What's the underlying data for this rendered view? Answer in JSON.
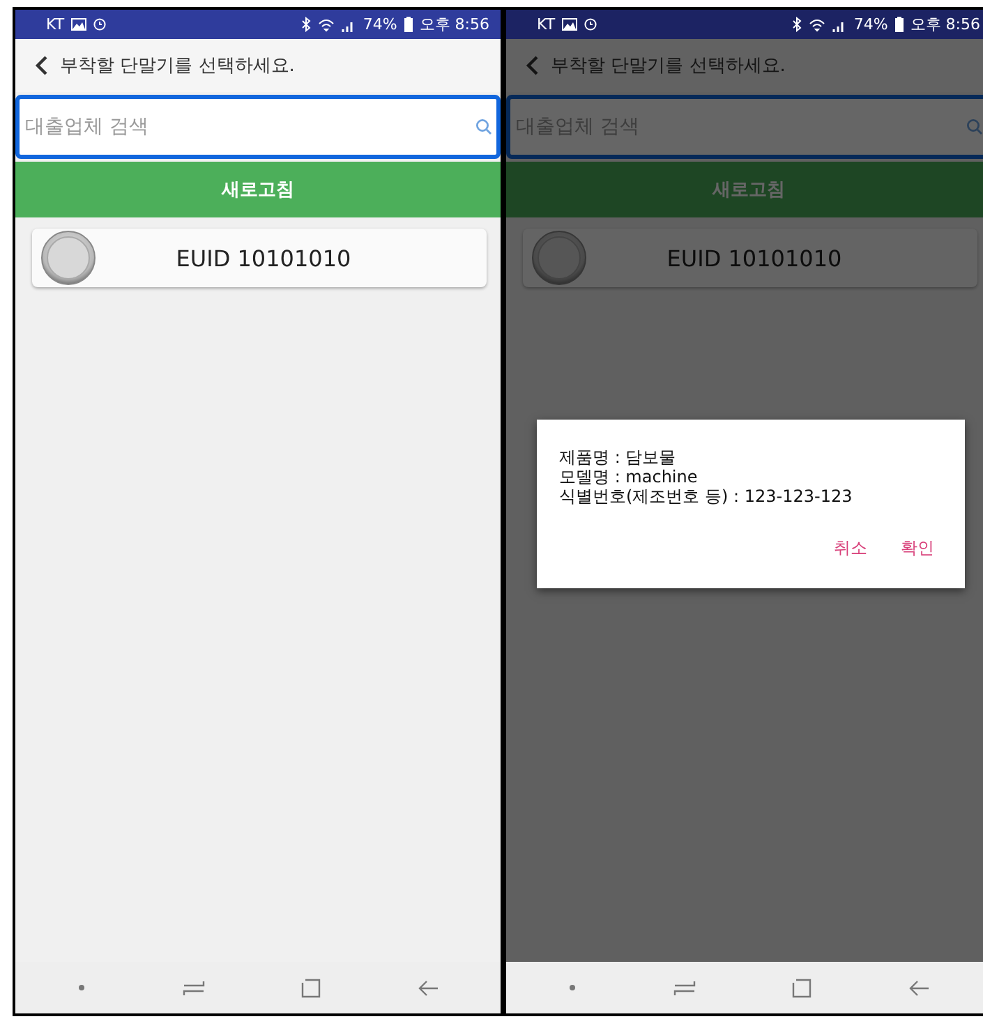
{
  "phones": [
    {
      "dimmed": false,
      "status_bar": {
        "carrier": "KT",
        "battery": "74%",
        "time": "오후 8:56"
      },
      "header": {
        "title": "부착할 단말기를 선택하세요."
      },
      "search": {
        "placeholder": "대출업체 검색"
      },
      "refresh_button": "새로고침",
      "devices": [
        {
          "label": "EUID 10101010"
        }
      ]
    },
    {
      "dimmed": true,
      "status_bar": {
        "carrier": "KT",
        "battery": "74%",
        "time": "오후 8:56"
      },
      "header": {
        "title": "부착할 단말기를 선택하세요."
      },
      "search": {
        "placeholder": "대출업체 검색"
      },
      "refresh_button": "새로고침",
      "devices": [
        {
          "label": "EUID 10101010"
        }
      ],
      "dialog": {
        "lines": [
          "제품명 : 담보물",
          "모델명 : machine",
          "식별번호(제조번호 등) : 123-123-123"
        ],
        "buttons": [
          "취소",
          "확인"
        ]
      }
    }
  ]
}
